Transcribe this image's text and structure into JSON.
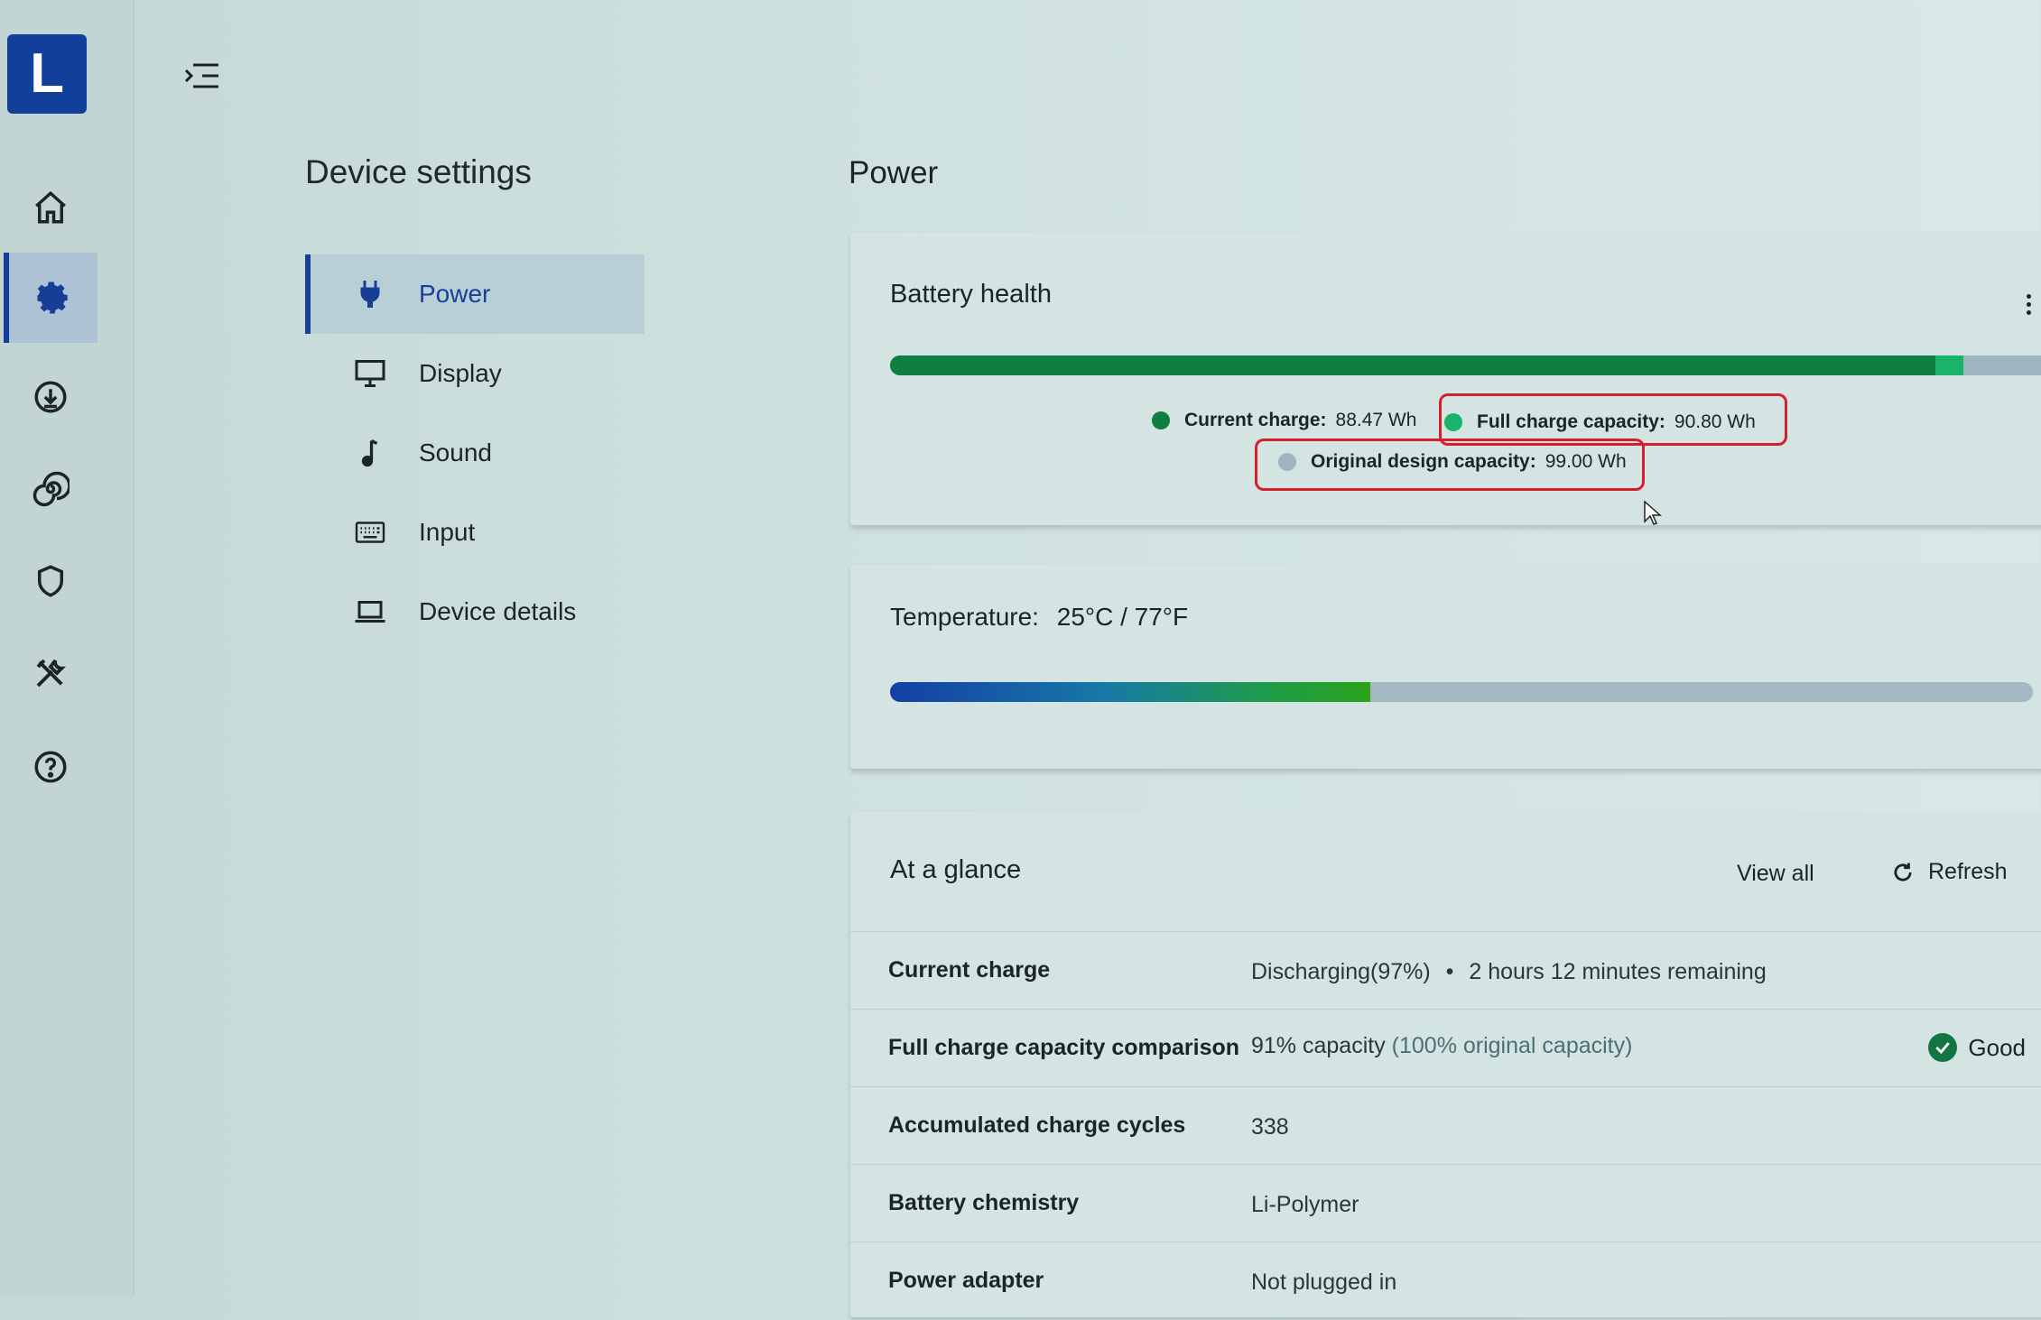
{
  "app": {
    "logo_letter": "L",
    "accent": "#153f96"
  },
  "rail": {
    "items": [
      {
        "icon": "home-icon"
      },
      {
        "icon": "gear-icon",
        "active": true
      },
      {
        "icon": "download-icon"
      },
      {
        "icon": "spiral-icon"
      },
      {
        "icon": "shield-icon"
      },
      {
        "icon": "tools-icon"
      },
      {
        "icon": "help-icon"
      }
    ]
  },
  "settings": {
    "title": "Device settings",
    "nav": [
      {
        "label": "Power",
        "icon": "plug-icon",
        "active": true
      },
      {
        "label": "Display",
        "icon": "monitor-icon"
      },
      {
        "label": "Sound",
        "icon": "music-note-icon"
      },
      {
        "label": "Input",
        "icon": "keyboard-icon"
      },
      {
        "label": "Device details",
        "icon": "laptop-icon"
      }
    ]
  },
  "main": {
    "title": "Power",
    "battery": {
      "title": "Battery health",
      "current_label": "Current charge:",
      "current_value": "88.47 Wh",
      "full_label": "Full charge capacity:",
      "full_value": "90.80 Wh",
      "design_label": "Original design capacity:",
      "design_value": "99.00 Wh",
      "current_fraction": 0.8936,
      "full_fraction": 0.9172,
      "colors": {
        "current": "#0f7f3f",
        "full": "#19b36b",
        "design": "#9fb6c0"
      }
    },
    "temperature": {
      "label": "Temperature:",
      "value": "25°C / 77°F",
      "fraction": 0.42
    },
    "glance": {
      "title": "At a glance",
      "view_all": "View all",
      "refresh": "Refresh",
      "rows": [
        {
          "key": "Current charge",
          "value": "Discharging(97%)",
          "sep": "•",
          "extra": "2 hours 12 minutes remaining"
        },
        {
          "key": "Full charge capacity comparison",
          "value": "91% capacity",
          "muted": "(100% original capacity)",
          "badge": "Good"
        },
        {
          "key": "Accumulated charge cycles",
          "value": "338"
        },
        {
          "key": "Battery chemistry",
          "value": "Li-Polymer"
        },
        {
          "key": "Power adapter",
          "value": "Not plugged in"
        }
      ]
    }
  }
}
